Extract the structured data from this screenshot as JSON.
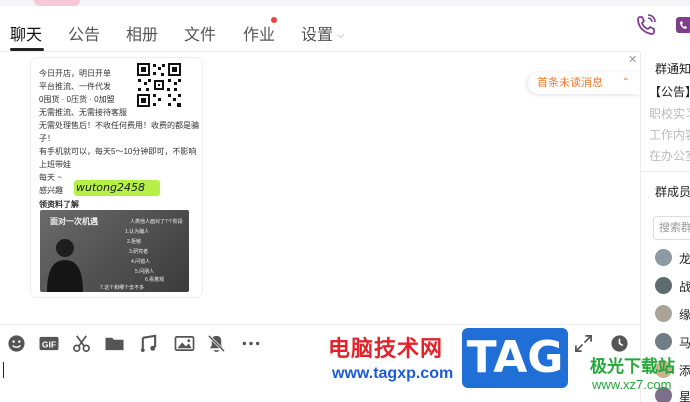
{
  "tabs": [
    {
      "label": "聊天",
      "active": true
    },
    {
      "label": "公告"
    },
    {
      "label": "相册"
    },
    {
      "label": "文件"
    },
    {
      "label": "作业",
      "badge": "dot"
    },
    {
      "label": "设置",
      "has_dropdown": true
    }
  ],
  "header_icons": [
    "phone-icon",
    "video-icon"
  ],
  "chat": {
    "unread_pill": {
      "label": "首条未读消息",
      "icon": "double-chevron-up-icon"
    },
    "close_icon": "close-icon",
    "image_message": {
      "lines": [
        "今日开店，明日开单",
        "平台推流、一件代发",
        "0囤货 · 0压货 · 0加盟",
        "无需推流、无需接待客服",
        "无需处理售后！不收任何费用！收费的都是骗",
        "子！",
        "有手机就可以，每天5～10分钟即可，不影响",
        "上班带娃",
        "每天 ~ ",
        "感兴趣",
        "领资料了解"
      ],
      "wechat_id": "wutong2458",
      "picture": {
        "title": "面对一次机遇",
        "caption": "人类他人面对了7个阶段",
        "steps": [
          "1.认为骗人",
          "2.拒敏",
          "3.研究者",
          "4.问错人",
          "5.问朋人",
          "6.看着观",
          "7.这个和哪个去不多"
        ]
      }
    }
  },
  "right_panel": {
    "notice_title": "群通知",
    "notice_lines": [
      "【公告】",
      "职校实习",
      "工作内容",
      "在办公室"
    ],
    "members_title": "群成员",
    "search_placeholder": "搜索群",
    "members": [
      "龙",
      "战",
      "缘",
      "马",
      "添",
      "星"
    ]
  },
  "toolbar": {
    "icons": [
      "emoji-icon",
      "gif-icon",
      "scissors-icon",
      "folder-icon",
      "music-icon",
      "image-icon",
      "mute-bell-icon",
      "more-icon",
      "expand-icon",
      "history-icon"
    ],
    "gif_label": "GIF"
  },
  "watermark": {
    "cn": "电脑技术网",
    "url": "www.tagxp.com",
    "tag": "TAG",
    "site": "极光下载站",
    "site_url": "www.xz7.com"
  },
  "colors": {
    "accent_orange": "#f07b2b",
    "tab_dot": "#e8433a",
    "header_icon": "#7d3f8c",
    "highlight_green": "#b6f046",
    "watermark_red": "#e3232b",
    "watermark_blue": "#1d5bd6",
    "watermark_green": "#27a63b"
  }
}
